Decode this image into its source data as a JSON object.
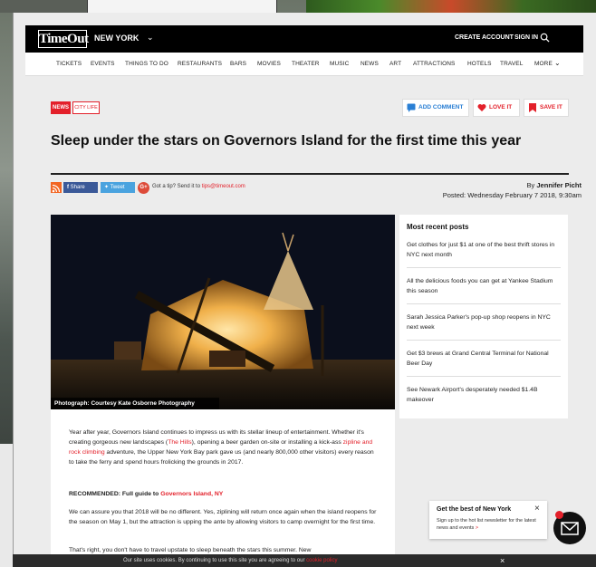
{
  "header": {
    "logo": "TimeOut",
    "city": "NEW YORK",
    "create_account": "CREATE ACCOUNT",
    "sign_in": "SIGN IN"
  },
  "nav": [
    "TICKETS",
    "EVENTS",
    "THINGS TO DO",
    "RESTAURANTS",
    "BARS",
    "MOVIES",
    "THEATER",
    "MUSIC",
    "NEWS",
    "ART",
    "ATTRACTIONS",
    "HOTELS",
    "TRAVEL",
    "MORE"
  ],
  "tags": {
    "news": "NEWS",
    "city_life": "CITY LIFE"
  },
  "actions": {
    "add_comment": "ADD COMMENT",
    "love_it": "LOVE IT",
    "save_it": "SAVE IT"
  },
  "article": {
    "title": "Sleep under the stars on Governors Island for the first time this year",
    "share_facebook": "Share",
    "share_twitter": "Tweet",
    "tip_text": "Got a tip? Send it to ",
    "tip_email": "tips@timeout.com",
    "byline_prefix": "By ",
    "author": "Jennifer Picht",
    "posted": "Posted: Wednesday February 7 2018, 9:30am",
    "photo_caption": "Photograph: Courtesy Kate Osborne Photography",
    "p1_a": "Year after year, Governors Island continues to impress us with its stellar lineup of entertainment. Whether it's creating gorgeous new landscapes (",
    "p1_link1": "The Hills",
    "p1_b": "), opening a beer garden on-site or installing a kick-ass ",
    "p1_link2": "zipline and rock climbing",
    "p1_c": " adventure, the Upper New York Bay park gave us (and nearly 800,000 other visitors) every reason to take the ferry and spend hours frolicking the grounds in 2017.",
    "recommended_label": "RECOMMENDED: Full guide to ",
    "recommended_link": "Governors Island, NY",
    "p2": "We can assure you that 2018 will be no different. Yes, ziplining will return once again when the island reopens for the season on May 1, but the attraction is upping the ante by allowing visitors to camp overnight for the first time.",
    "p3": "That's right, you don't have to travel upstate to sleep beneath the stars this summer. New"
  },
  "sidebar": {
    "title": "Most recent posts",
    "items": [
      "Get clothes for just $1 at one of the best thrift stores in NYC next month",
      "All the delicious foods you can get at Yankee Stadium this season",
      "Sarah Jessica Parker's pop-up shop reopens in NYC next week",
      "Get $3 brews at Grand Central Terminal for National Beer Day",
      "See Newark Airport's desperately needed $1.4B makeover"
    ]
  },
  "newsletter": {
    "title": "Get the best of New York",
    "text": "Sign up to the hot list newsletter for the latest news and events",
    "arrow": ">"
  },
  "cookie": {
    "text": "Our site uses cookies. By continuing to use this site you are agreeing to our ",
    "link": "cookie policy"
  },
  "colors": {
    "brand_red": "#e3202a",
    "header_bg": "#000000",
    "facebook": "#3b5998",
    "twitter": "#4aa3df"
  }
}
